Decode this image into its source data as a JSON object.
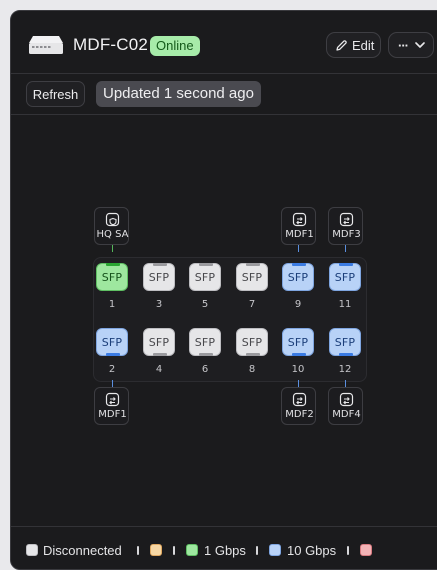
{
  "device": {
    "name": "MDF-C02",
    "status": "Online"
  },
  "header": {
    "edit_label": "Edit",
    "more_label": "···"
  },
  "toolbar": {
    "refresh_label": "Refresh",
    "updated_text": "Updated 1 second ago"
  },
  "ports_top": [
    {
      "label": "SFP",
      "number": "1",
      "state": "1 Gbps"
    },
    {
      "label": "SFP",
      "number": "3",
      "state": "Disconnected"
    },
    {
      "label": "SFP",
      "number": "5",
      "state": "Disconnected"
    },
    {
      "label": "SFP",
      "number": "7",
      "state": "Disconnected"
    },
    {
      "label": "SFP",
      "number": "9",
      "state": "10 Gbps"
    },
    {
      "label": "SFP",
      "number": "11",
      "state": "10 Gbps"
    }
  ],
  "ports_bottom": [
    {
      "label": "SFP",
      "number": "2",
      "state": "10 Gbps"
    },
    {
      "label": "SFP",
      "number": "4",
      "state": "Disconnected"
    },
    {
      "label": "SFP",
      "number": "6",
      "state": "Disconnected"
    },
    {
      "label": "SFP",
      "number": "8",
      "state": "Disconnected"
    },
    {
      "label": "SFP",
      "number": "10",
      "state": "10 Gbps"
    },
    {
      "label": "SFP",
      "number": "12",
      "state": "10 Gbps"
    }
  ],
  "neighbors": {
    "port1": "HQ SA",
    "port9": "MDF1",
    "port11": "MDF3",
    "port2": "MDF1",
    "port10": "MDF2",
    "port12": "MDF4"
  },
  "legend": {
    "disconnected": "Disconnected",
    "gbps1": "1 Gbps",
    "gbps10": "10 Gbps"
  },
  "colors": {
    "online_badge": "#a7eba9",
    "port_1gbps": "#9ee79f",
    "port_10gbps": "#b8d2f7",
    "port_disconnected": "#e6e6e8",
    "legend_orange": "#f7d7a4",
    "legend_red": "#f3b3b6"
  },
  "icons": {
    "device": "switch-device-icon",
    "edit": "pencil-icon",
    "more": "chevron-down-icon",
    "hq_sa": "shield-device-icon",
    "mdf": "switch-swap-icon"
  }
}
